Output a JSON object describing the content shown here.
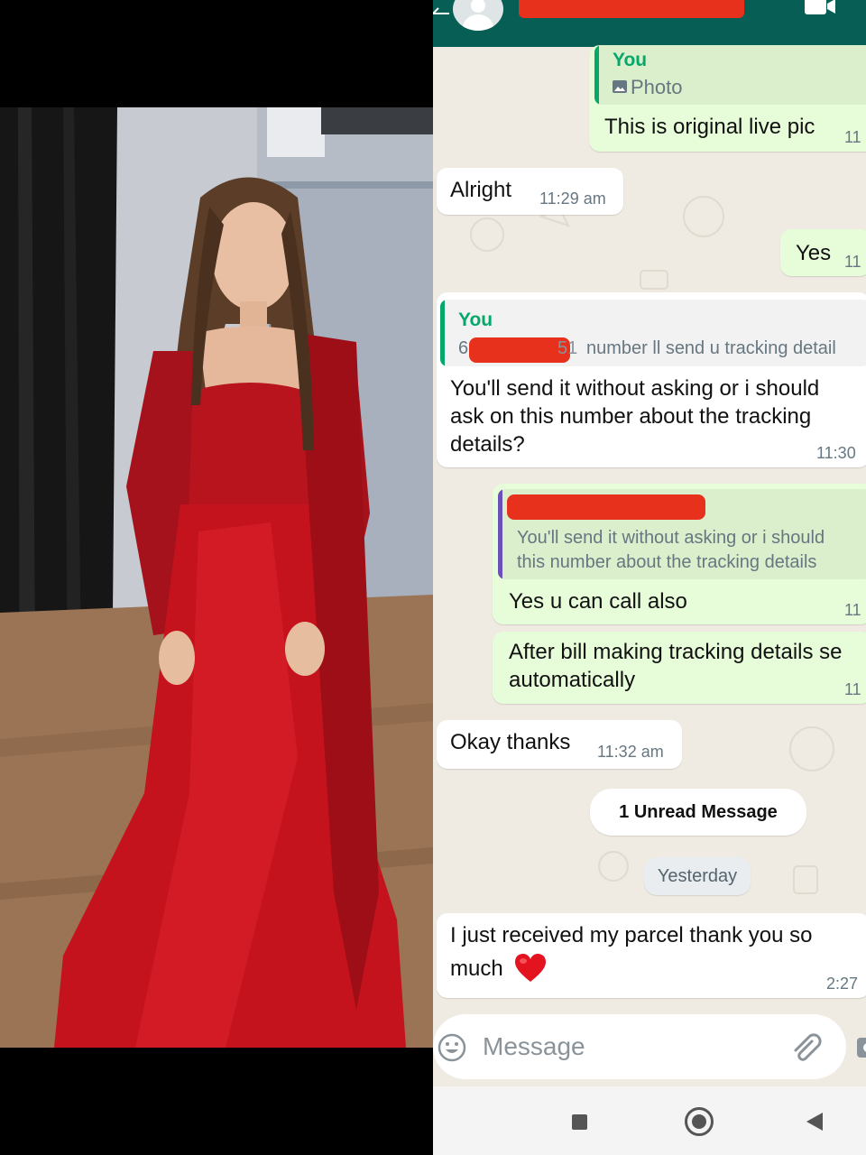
{
  "chat": {
    "messages": [
      {
        "direction": "outgoing",
        "quote_author": "You",
        "quote_text": "Photo",
        "text": "This is original live pic",
        "time": "11"
      },
      {
        "direction": "incoming",
        "text": "Alright",
        "time": "11:29 am"
      },
      {
        "direction": "outgoing",
        "text": "Yes",
        "time": "11"
      },
      {
        "direction": "incoming",
        "quote_author": "You",
        "quote_text_visible": "number ll send u tracking detail",
        "quote_text_prefix": "6",
        "quote_text_prefix2": "51",
        "lines": [
          "You'll send it without asking or i should",
          "ask on this number about the tracking",
          "details?"
        ],
        "time": "11:30"
      },
      {
        "direction": "outgoing",
        "quote_lines": [
          "You'll send it without asking or i should",
          "this number about the tracking details"
        ],
        "text": "Yes u can call also",
        "time": "11"
      },
      {
        "direction": "outgoing",
        "lines": [
          "After bill making tracking details se",
          "automatically"
        ],
        "time": "11"
      },
      {
        "direction": "incoming",
        "text": "Okay thanks",
        "time": "11:32 am"
      },
      {
        "direction": "incoming",
        "lines": [
          "I just received my parcel thank you so",
          "much"
        ],
        "emoji": "heart",
        "time": "2:27"
      }
    ],
    "unread_label": "1 Unread Message",
    "date_label": "Yesterday",
    "input_placeholder": "Message"
  },
  "icons": {
    "back": "back-arrow-icon",
    "avatar": "default-avatar-icon",
    "video": "video-call-icon",
    "photo": "photo-icon",
    "emoji": "emoji-icon",
    "attach": "paperclip-icon",
    "camera": "camera-icon",
    "heart": "red-heart-emoji",
    "nav_recents": "square-recents-icon",
    "nav_home": "circle-home-icon",
    "nav_back": "triangle-back-icon"
  },
  "colors": {
    "header": "#075e54",
    "outgoing_bubble": "#e7fcd8",
    "incoming_bubble": "#ffffff",
    "chat_background": "#efeae2",
    "quote_author": "#06a76a",
    "quote_bar_green": "#06a76a",
    "quote_bar_purple": "#6b4fbb",
    "redaction": "#e8311d",
    "timestamp": "#667781"
  }
}
